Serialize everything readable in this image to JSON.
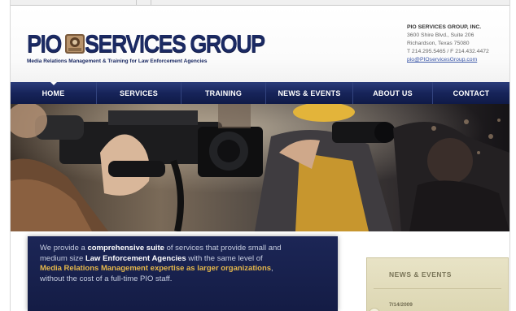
{
  "brand": {
    "logo_left": "PIO",
    "logo_right": "SERVICES GROUP",
    "tagline": "Media Relations Management & Training for Law Enforcement Agencies",
    "primary_color": "#1b2a63"
  },
  "contact": {
    "company": "PIO SERVICES GROUP, INC.",
    "address1": "3600 Shire Blvd., Suite 206",
    "address2": "Richardson, Texas 75080",
    "phones": "T 214.295.5465 / F 214.432.4472",
    "email": "pio@PIOservicesGroup.com"
  },
  "nav": {
    "items": [
      {
        "label": "HOME",
        "active": true
      },
      {
        "label": "SERVICES"
      },
      {
        "label": "TRAINING"
      },
      {
        "label": "NEWS & EVENTS"
      },
      {
        "label": "ABOUT US"
      },
      {
        "label": "CONTACT"
      }
    ]
  },
  "blurb": {
    "p1": "We provide a ",
    "p2": "comprehensive suite",
    "p3": " of services that provide small and",
    "p4": "medium size ",
    "p5": "Law Enforcement Agencies",
    "p6": " with the same level of",
    "p7": "Media Relations Management expertise as larger organizations",
    "p8": ",",
    "p9": "without the cost of a full-time PIO staff.",
    "highlight_color": "#e6b84b"
  },
  "news": {
    "title": "NEWS & EVENTS",
    "date": "7/14/2009"
  }
}
